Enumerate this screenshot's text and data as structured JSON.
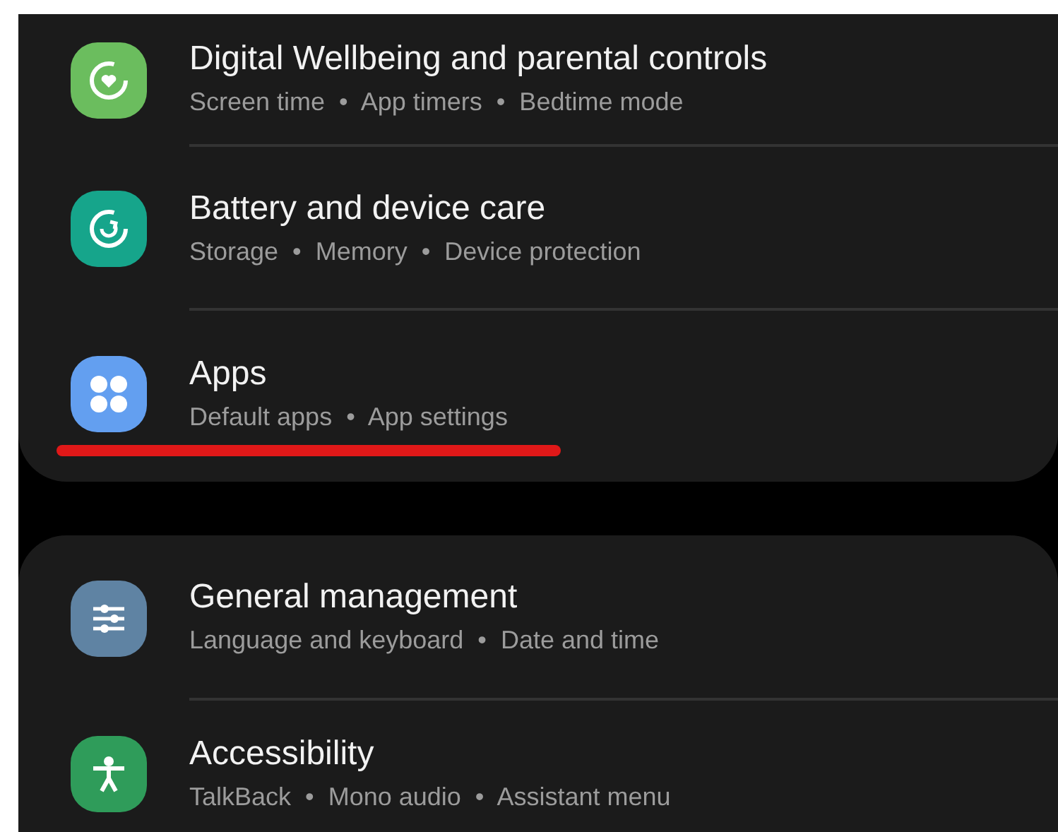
{
  "sections": [
    {
      "items": [
        {
          "kind": "wellbeing",
          "color": "#6bbd5e",
          "title": "Digital Wellbeing and parental controls",
          "subtitle": "Screen time  •  App timers  •  Bedtime mode",
          "underlined": false
        },
        {
          "kind": "care",
          "color": "#16a58b",
          "title": "Battery and device care",
          "subtitle": "Storage  •  Memory  •  Device protection",
          "underlined": false
        },
        {
          "kind": "apps",
          "color": "#639ff0",
          "title": "Apps",
          "subtitle": "Default apps  •  App settings",
          "underlined": true
        }
      ]
    },
    {
      "items": [
        {
          "kind": "sliders",
          "color": "#5f83a3",
          "title": "General management",
          "subtitle": "Language and keyboard  •  Date and time",
          "underlined": false
        },
        {
          "kind": "person",
          "color": "#2f9c5a",
          "title": "Accessibility",
          "subtitle": "TalkBack  •  Mono audio  •  Assistant menu",
          "underlined": false
        }
      ]
    }
  ]
}
